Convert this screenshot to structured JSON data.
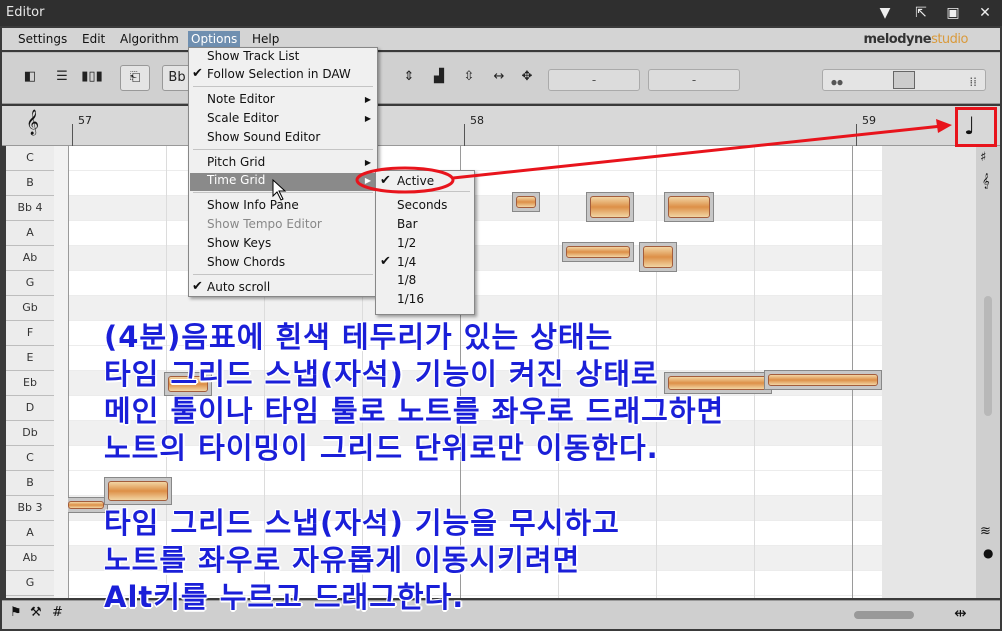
{
  "window": {
    "title": "Editor"
  },
  "menubar": {
    "items": [
      "Settings",
      "Edit",
      "Algorithm",
      "Options",
      "Help"
    ],
    "logo_main": "melodyne",
    "logo_sub": "studio"
  },
  "toolbar": {
    "key_button": "Bb",
    "field1": "-",
    "field2": "-"
  },
  "ruler": {
    "bars": [
      "57",
      "58",
      "59"
    ]
  },
  "keys": [
    "C",
    "B",
    "Bb 4",
    "A",
    "Ab",
    "G",
    "Gb",
    "F",
    "E",
    "Eb",
    "D",
    "Db",
    "C",
    "B",
    "Bb 3",
    "A",
    "Ab",
    "G"
  ],
  "options_menu": {
    "items": [
      {
        "label": "Show Track List",
        "checked": false,
        "submenu": false,
        "disabled": false
      },
      {
        "label": "Follow Selection in DAW",
        "checked": true,
        "submenu": false,
        "disabled": false
      },
      {
        "label": "Note Editor",
        "checked": false,
        "submenu": true,
        "disabled": false
      },
      {
        "label": "Scale Editor",
        "checked": false,
        "submenu": true,
        "disabled": false
      },
      {
        "label": "Show Sound Editor",
        "checked": false,
        "submenu": false,
        "disabled": false
      },
      {
        "label": "Pitch Grid",
        "checked": false,
        "submenu": true,
        "disabled": false
      },
      {
        "label": "Time Grid",
        "checked": false,
        "submenu": true,
        "disabled": false
      },
      {
        "label": "Show Info Pane",
        "checked": false,
        "submenu": false,
        "disabled": false
      },
      {
        "label": "Show Tempo Editor",
        "checked": false,
        "submenu": false,
        "disabled": true
      },
      {
        "label": "Show Keys",
        "checked": false,
        "submenu": false,
        "disabled": false
      },
      {
        "label": "Show Chords",
        "checked": false,
        "submenu": false,
        "disabled": false
      },
      {
        "label": "Auto scroll",
        "checked": true,
        "submenu": false,
        "disabled": false
      }
    ]
  },
  "time_grid_submenu": {
    "items": [
      {
        "label": "Active",
        "checked": true
      },
      {
        "label": "Seconds",
        "checked": false
      },
      {
        "label": "Bar",
        "checked": false
      },
      {
        "label": "1/2",
        "checked": false
      },
      {
        "label": "1/4",
        "checked": true
      },
      {
        "label": "1/8",
        "checked": false
      },
      {
        "label": "1/16",
        "checked": false
      }
    ]
  },
  "annotation": {
    "lines": [
      "(4분)음표에 흰색 테두리가 있는 상태는",
      "타임 그리드 스냅(자석) 기능이 켜진 상태로",
      "메인 툴이나 타임 툴로 노트를 좌우로 드래그하면",
      "노트의 타이밍이 그리드 단위로만 이동한다.",
      "타임 그리드 스냅(자석) 기능을 무시하고",
      "노트를 좌우로 자유롭게 이동시키려면",
      "Alt키를 누르고 드래그한다."
    ]
  },
  "colors": {
    "annotation": "#1a1fd8",
    "highlight": "#e8141c",
    "menu_highlight": "#6f8fb0",
    "blob": "#e08a3a"
  }
}
